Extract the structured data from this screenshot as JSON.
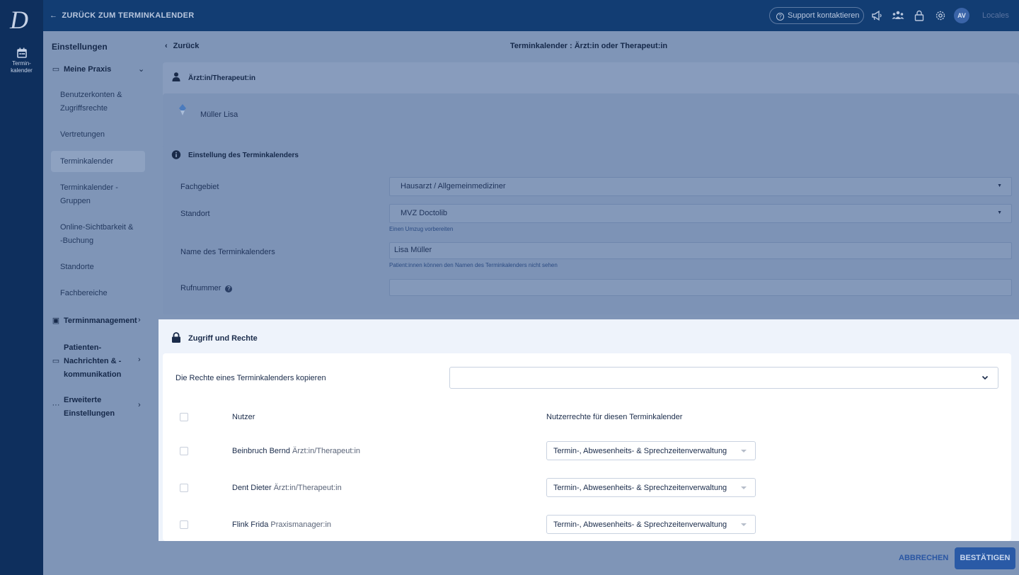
{
  "rail": {
    "logo": "D",
    "calendar_label_1": "Termin-",
    "calendar_label_2": "kalender"
  },
  "topbar": {
    "back_link": "ZURÜCK ZUM TERMINKALENDER",
    "support": "Support kontaktieren",
    "avatar": "AV",
    "locales": "Locales",
    "icons": [
      "megaphone-icon",
      "team-icon",
      "lock-icon",
      "gear-icon"
    ]
  },
  "sidebar": {
    "title": "Einstellungen",
    "group_meine_praxis": "Meine Praxis",
    "items": [
      {
        "label": "Benutzerkonten & Zugriffsrechte"
      },
      {
        "label": "Vertretungen"
      },
      {
        "label": "Terminkalender"
      },
      {
        "label": "Terminkalender - Gruppen"
      },
      {
        "label": "Online-Sichtbarkeit & -Buchung"
      },
      {
        "label": "Standorte"
      },
      {
        "label": "Fachbereiche"
      }
    ],
    "group_terminmanagement": "Terminmanagement",
    "group_patienten": "Patienten-Nachrichten & -kommunikation",
    "group_erweitert": "Erweiterte Einstellungen"
  },
  "header": {
    "back": "Zurück",
    "title": "Terminkalender : Ärzt:in oder Therapeut:in"
  },
  "doctor_section": {
    "title": "Ärzt:in/Therapeut:in",
    "name": "Müller Lisa"
  },
  "settings_section": {
    "title": "Einstellung des Terminkalenders",
    "fachgebiet_label": "Fachgebiet",
    "fachgebiet_value": "Hausarzt / Allgemeinmediziner",
    "standort_label": "Standort",
    "standort_value": "MVZ Doctolib",
    "standort_hint": "Einen Umzug vorbereiten",
    "name_label": "Name des Terminkalenders",
    "name_value": "Lisa Müller",
    "name_hint": "Patient:innen können den Namen des Terminkalenders nicht sehen",
    "phone_label": "Rufnummer",
    "phone_value": ""
  },
  "access_section": {
    "title": "Zugriff und Rechte",
    "copy_label": "Die Rechte eines Terminkalenders kopieren",
    "copy_value": "",
    "col_user": "Nutzer",
    "col_rights": "Nutzerrechte für diesen Terminkalender",
    "users": [
      {
        "name": "Beinbruch Bernd",
        "role": "Ärzt:in/Therapeut:in",
        "rights": "Termin-, Abwesenheits- & Sprechzeitenverwaltung"
      },
      {
        "name": "Dent Dieter",
        "role": "Ärzt:in/Therapeut:in",
        "rights": "Termin-, Abwesenheits- & Sprechzeitenverwaltung"
      },
      {
        "name": "Flink Frida",
        "role": "Praxismanager:in",
        "rights": "Termin-, Abwesenheits- & Sprechzeitenverwaltung"
      }
    ]
  },
  "footer": {
    "cancel": "ABBRECHEN",
    "confirm": "BESTÄTIGEN"
  }
}
